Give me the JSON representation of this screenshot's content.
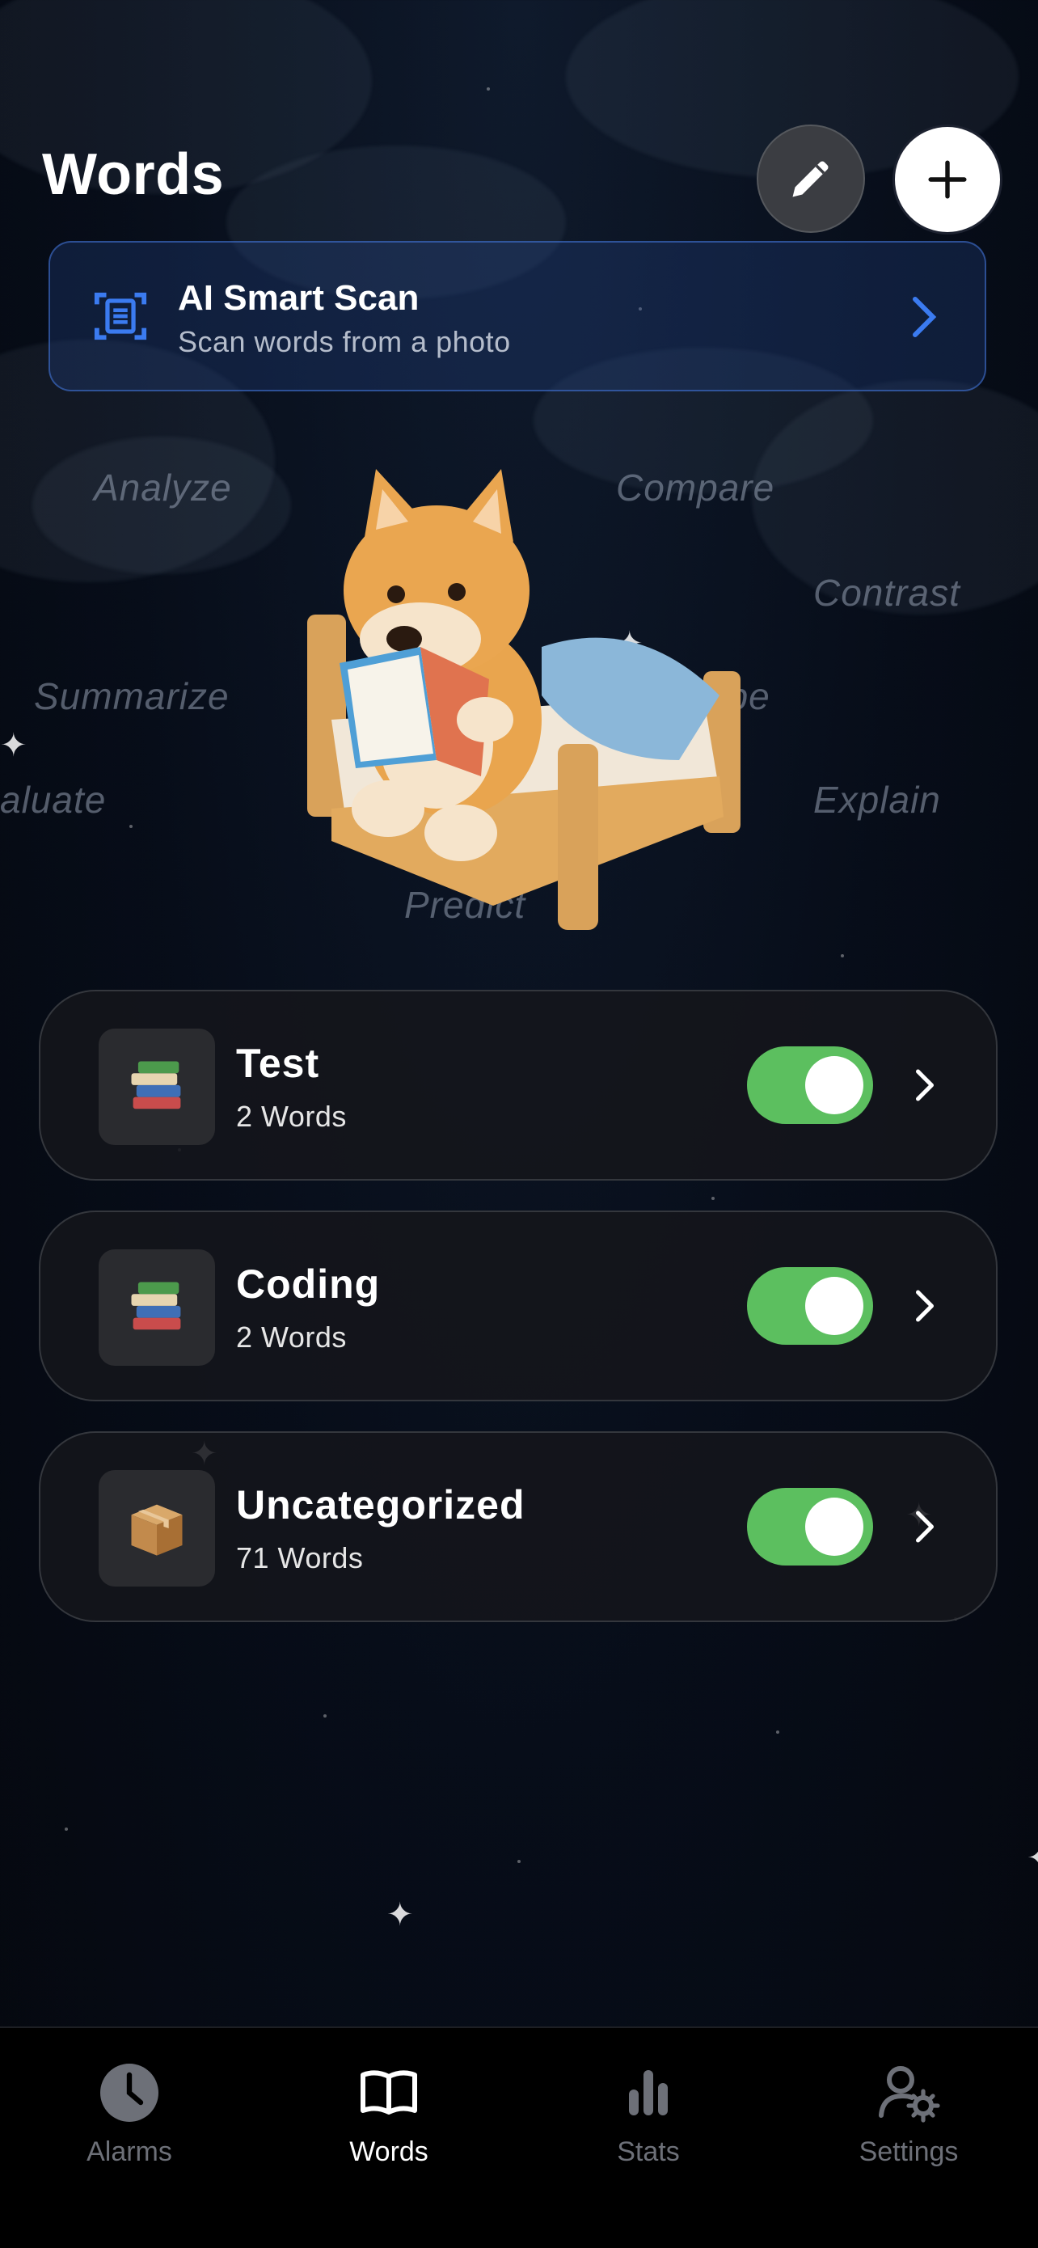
{
  "header": {
    "title": "Words"
  },
  "scan_card": {
    "title": "AI Smart Scan",
    "subtitle": "Scan words from a photo"
  },
  "floating_words": [
    "Analyze",
    "Compare",
    "Contrast",
    "Summarize",
    "ribe",
    "aluate",
    "Explain",
    "Predict"
  ],
  "categories": [
    {
      "name": "Test",
      "count": "2 Words",
      "icon": "books-icon",
      "enabled": true
    },
    {
      "name": "Coding",
      "count": "2 Words",
      "icon": "books-icon",
      "enabled": true
    },
    {
      "name": "Uncategorized",
      "count": "71 Words",
      "icon": "box-icon",
      "enabled": true
    }
  ],
  "tabbar": {
    "items": [
      {
        "label": "Alarms",
        "icon": "clock-icon",
        "active": false
      },
      {
        "label": "Words",
        "icon": "book-icon",
        "active": true
      },
      {
        "label": "Stats",
        "icon": "bar-chart-icon",
        "active": false
      },
      {
        "label": "Settings",
        "icon": "user-gear-icon",
        "active": false
      }
    ]
  },
  "colors": {
    "toggle_on": "#5cbf5f",
    "accent_blue": "#3b7bf0",
    "background": "#070d19"
  }
}
